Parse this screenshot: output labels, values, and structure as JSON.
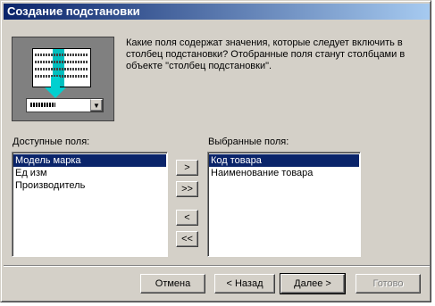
{
  "window": {
    "title": "Создание подстановки"
  },
  "description": "Какие поля содержат значения, которые следует включить в столбец подстановки? Отобранные поля станут столбцами в объекте \"столбец подстановки\".",
  "available": {
    "label": "Доступные поля:",
    "items": [
      "Модель марка",
      "Ед изм",
      "Производитель"
    ],
    "selected_index": 0
  },
  "selected": {
    "label": "Выбранные поля:",
    "items": [
      "Код товара",
      "Наименование товара"
    ],
    "selected_index": 0
  },
  "move_buttons": {
    "add_one": ">",
    "add_all": ">>",
    "remove_one": "<",
    "remove_all": "<<"
  },
  "footer": {
    "cancel": "Отмена",
    "back": "< Назад",
    "next": "Далее >",
    "finish": "Готово"
  }
}
